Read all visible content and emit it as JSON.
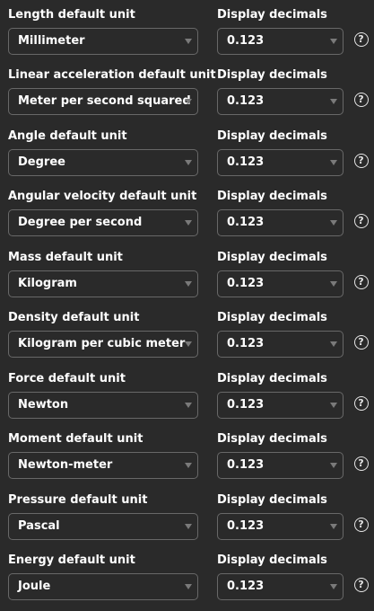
{
  "rows": [
    {
      "unit_label": "Length default unit",
      "unit_value": "Millimeter",
      "decimals_label": "Display decimals",
      "decimals_value": "0.123",
      "help_glyph": "?"
    },
    {
      "unit_label": "Linear acceleration default unit",
      "unit_value": "Meter per second squared",
      "decimals_label": "Display decimals",
      "decimals_value": "0.123",
      "help_glyph": "?"
    },
    {
      "unit_label": "Angle default unit",
      "unit_value": "Degree",
      "decimals_label": "Display decimals",
      "decimals_value": "0.123",
      "help_glyph": "?"
    },
    {
      "unit_label": "Angular velocity default unit",
      "unit_value": "Degree per second",
      "decimals_label": "Display decimals",
      "decimals_value": "0.123",
      "help_glyph": "?"
    },
    {
      "unit_label": "Mass default unit",
      "unit_value": "Kilogram",
      "decimals_label": "Display decimals",
      "decimals_value": "0.123",
      "help_glyph": "?"
    },
    {
      "unit_label": "Density default unit",
      "unit_value": "Kilogram per cubic meter",
      "decimals_label": "Display decimals",
      "decimals_value": "0.123",
      "help_glyph": "?"
    },
    {
      "unit_label": "Force default unit",
      "unit_value": "Newton",
      "decimals_label": "Display decimals",
      "decimals_value": "0.123",
      "help_glyph": "?"
    },
    {
      "unit_label": "Moment default unit",
      "unit_value": "Newton-meter",
      "decimals_label": "Display decimals",
      "decimals_value": "0.123",
      "help_glyph": "?"
    },
    {
      "unit_label": "Pressure default unit",
      "unit_value": "Pascal",
      "decimals_label": "Display decimals",
      "decimals_value": "0.123",
      "help_glyph": "?"
    },
    {
      "unit_label": "Energy default unit",
      "unit_value": "Joule",
      "decimals_label": "Display decimals",
      "decimals_value": "0.123",
      "help_glyph": "?"
    }
  ],
  "icons": {
    "dropdown_caret": "chevron-down-icon",
    "help": "help-circle-icon"
  },
  "colors": {
    "background": "#2a2a2a",
    "text": "#ffffff",
    "select_border": "#686868",
    "caret": "#7a7a7a"
  }
}
